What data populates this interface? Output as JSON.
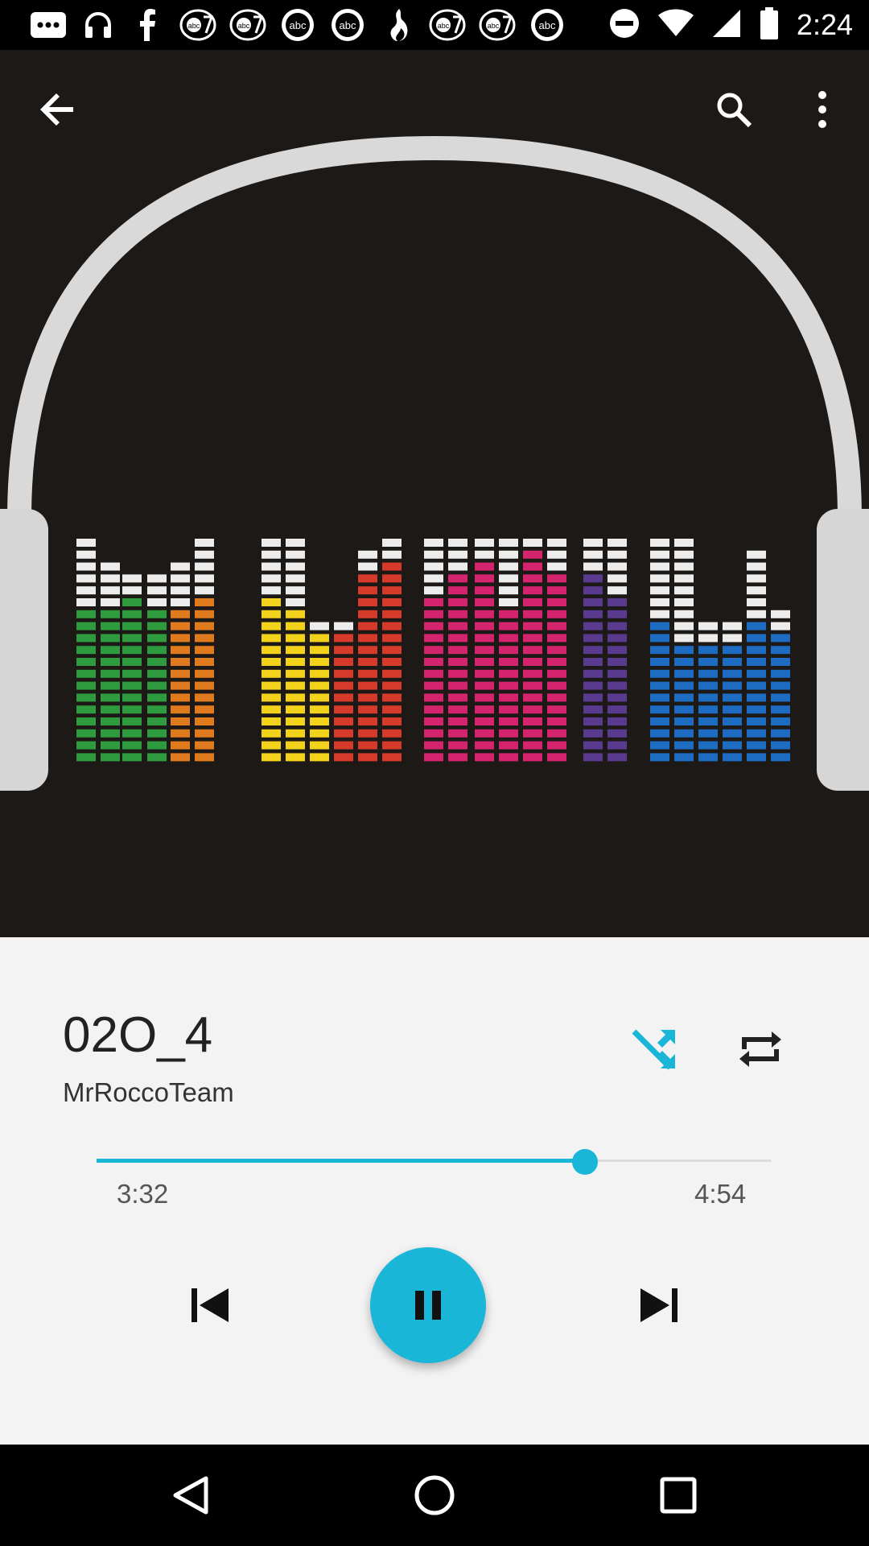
{
  "status_bar": {
    "time": "2:24",
    "notification_icons": [
      "more-notifications-icon",
      "headphones-icon",
      "facebook-icon",
      "abc7-icon",
      "abc7-icon",
      "abc-icon",
      "abc-icon",
      "flame-icon",
      "abc7-icon",
      "abc7-icon",
      "abc-icon"
    ],
    "system_icons": [
      "do-not-disturb-icon",
      "wifi-icon",
      "signal-icon",
      "battery-icon"
    ]
  },
  "toolbar": {
    "back_icon": "arrow-back-icon",
    "search_icon": "search-icon",
    "menu_icon": "more-vert-icon"
  },
  "album_art": {
    "word": "MUSIC",
    "colors": [
      "#2e9b3e",
      "#e07a1f",
      "#f2d21a",
      "#d63a2b",
      "#d5246e",
      "#5a3a8f",
      "#1e6bc2"
    ]
  },
  "track": {
    "title": "02O_4",
    "artist": "MrRoccoTeam",
    "elapsed": "3:32",
    "duration": "4:54",
    "progress": 0.724
  },
  "controls": {
    "shuffle_icon": "shuffle-icon",
    "repeat_icon": "repeat-icon",
    "previous_icon": "skip-previous-icon",
    "pause_icon": "pause-icon",
    "next_icon": "skip-next-icon"
  },
  "colors": {
    "accent": "#19b6d8",
    "art_background": "#1c1916",
    "panel_background": "#f3f3f3"
  },
  "navigation_bar": [
    "back-triangle-icon",
    "home-circle-icon",
    "recents-square-icon"
  ]
}
